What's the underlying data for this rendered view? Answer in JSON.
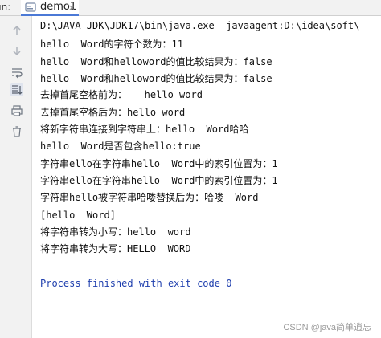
{
  "panel": {
    "run_label": "un:",
    "tab_label": "demo1",
    "tab_close": "×"
  },
  "toolbar_icons": [
    "arrow-up-icon",
    "arrow-down-icon",
    "soft-wrap-icon",
    "scroll-to-end-icon",
    "print-icon",
    "clear-icon"
  ],
  "console": {
    "lines": [
      "D:\\JAVA-JDK\\JDK17\\bin\\java.exe -javaagent:D:\\idea\\soft\\",
      "hello  Word的字符个数为：11",
      "hello  Word和helloword的值比较结果为：false",
      "hello  Word和helloword的值比较结果为：false",
      "去掉首尾空格前为：   hello word",
      "去掉首尾空格后为：hello word",
      "将新字符串连接到字符串上：hello  Word哈哈",
      "hello  Word是否包含hello:true",
      "字符串ello在字符串hello  Word中的索引位置为：1",
      "字符串ello在字符串hello  Word中的索引位置为：1",
      "字符串hello被字符串哈喽替换后为：哈喽  Word",
      "[hello  Word]",
      "将字符串转为小写：hello  word",
      "将字符串转为大写：HELLO  WORD",
      "",
      "Process finished with exit code 0"
    ]
  },
  "watermark": "CSDN @java简单逍忘",
  "colors": {
    "accent": "#4b79d6",
    "exit_text": "#1f3fae",
    "gutter_bg": "#f2f2f2"
  }
}
